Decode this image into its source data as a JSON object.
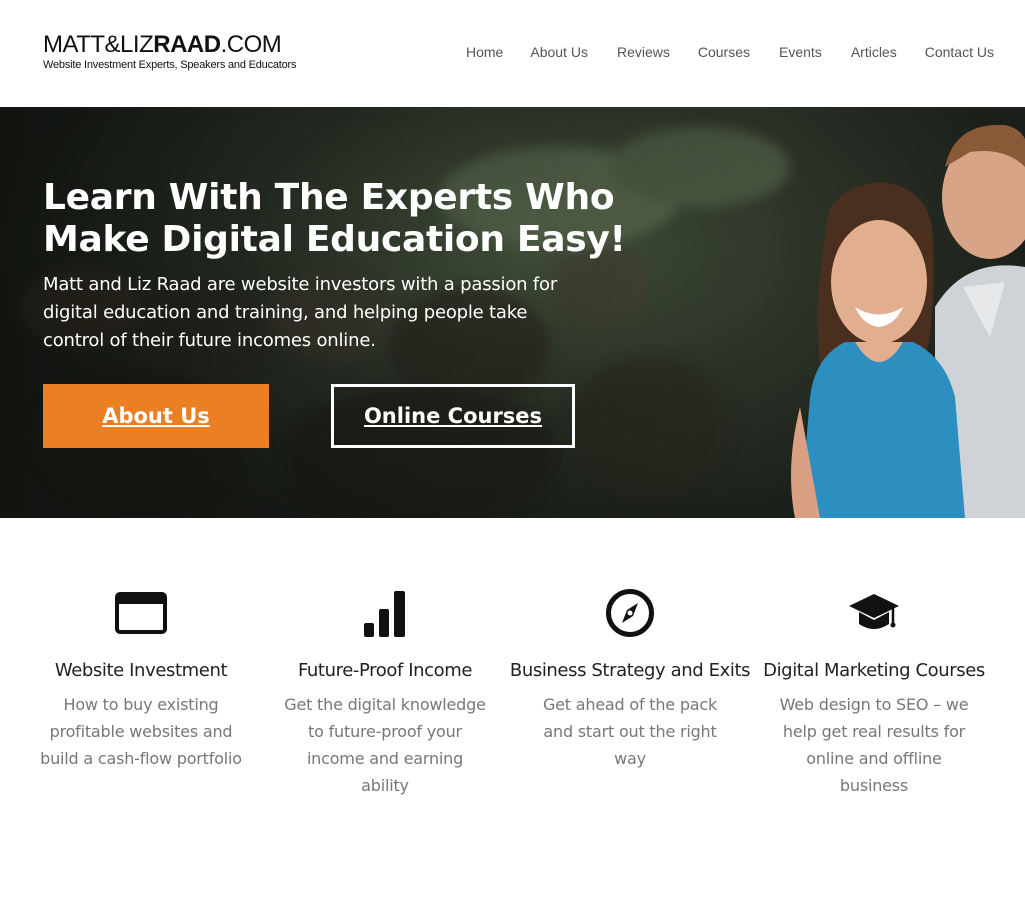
{
  "header": {
    "logo_prefix": "MATT&LIZ",
    "logo_bold": "RAAD",
    "logo_suffix": ".COM",
    "tagline": "Website Investment Experts, Speakers and Educators"
  },
  "nav": {
    "items": [
      {
        "label": "Home"
      },
      {
        "label": "About Us"
      },
      {
        "label": "Reviews"
      },
      {
        "label": "Courses"
      },
      {
        "label": "Events"
      },
      {
        "label": "Articles"
      },
      {
        "label": "Contact Us"
      }
    ]
  },
  "hero": {
    "title_line1": "Learn With The Experts Who",
    "title_line2": "Make Digital Education Easy!",
    "subtitle": "Matt and Liz Raad are website investors with a passion for digital education and training, and helping people take control of their future incomes online.",
    "primary_button": "About Us",
    "secondary_button": "Online Courses"
  },
  "features": [
    {
      "icon": "browser-window-icon",
      "title": "Website Investment",
      "text": "How to buy existing profitable websites and build a cash-flow portfolio"
    },
    {
      "icon": "bar-chart-icon",
      "title": "Future-Proof Income",
      "text": "Get the digital knowledge to future-proof your income and earning ability"
    },
    {
      "icon": "compass-icon",
      "title": "Business Strategy and Exits",
      "text": "Get ahead of the pack and start out the right way"
    },
    {
      "icon": "graduation-cap-icon",
      "title": "Digital Marketing Courses",
      "text": "Web design to SEO – we help get real results for online and offline business"
    }
  ],
  "colors": {
    "accent": "#eb7f23",
    "nav_text": "#555555",
    "body_text": "#777777"
  }
}
